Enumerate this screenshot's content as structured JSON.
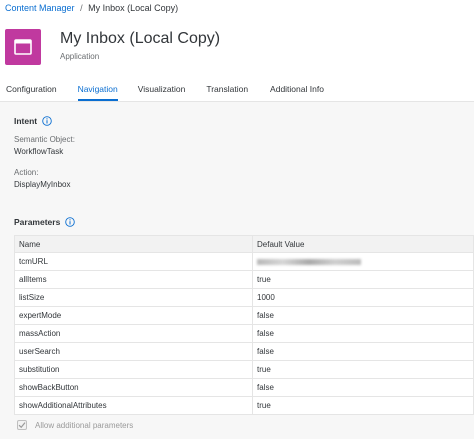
{
  "breadcrumb": {
    "link": "Content Manager",
    "separator": "/",
    "current": "My Inbox (Local Copy)"
  },
  "app": {
    "title": "My Inbox (Local Copy)",
    "type": "Application",
    "icon": "window-icon",
    "icon_color": "#c0399f"
  },
  "tabs": [
    {
      "label": "Configuration",
      "active": false
    },
    {
      "label": "Navigation",
      "active": true
    },
    {
      "label": "Visualization",
      "active": false
    },
    {
      "label": "Translation",
      "active": false
    },
    {
      "label": "Additional Info",
      "active": false
    }
  ],
  "intent": {
    "title": "Intent",
    "semantic_object_label": "Semantic Object:",
    "semantic_object_value": "WorkflowTask",
    "action_label": "Action:",
    "action_value": "DisplayMyInbox"
  },
  "parameters": {
    "title": "Parameters",
    "columns": [
      "Name",
      "Default Value"
    ],
    "rows": [
      {
        "name": "tcmURL",
        "value": "",
        "blurred": true
      },
      {
        "name": "allItems",
        "value": "true"
      },
      {
        "name": "listSize",
        "value": "1000"
      },
      {
        "name": "expertMode",
        "value": "false"
      },
      {
        "name": "massAction",
        "value": "false"
      },
      {
        "name": "userSearch",
        "value": "false"
      },
      {
        "name": "substitution",
        "value": "true"
      },
      {
        "name": "showBackButton",
        "value": "false"
      },
      {
        "name": "showAdditionalAttributes",
        "value": "true"
      }
    ],
    "allow_additional_label": "Allow additional parameters",
    "allow_additional_checked": true
  },
  "colors": {
    "accent": "#0a6ed1",
    "app_icon": "#c0399f",
    "content_bg": "#f7f7f7"
  }
}
